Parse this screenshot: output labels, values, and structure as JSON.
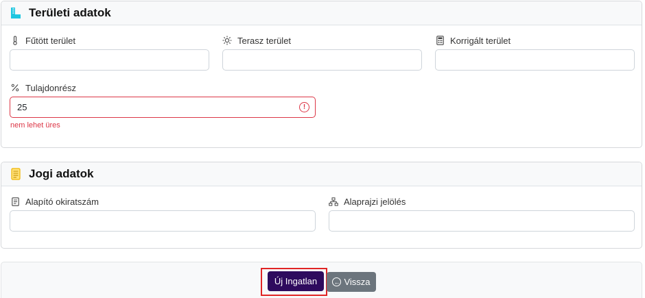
{
  "areal_section": {
    "title": "Területi adatok",
    "icon": "ruler-icon",
    "fields": {
      "heated_area": {
        "label": "Fűtött terület",
        "icon": "thermometer-icon",
        "value": "",
        "placeholder": ""
      },
      "terrace_area": {
        "label": "Terasz terület",
        "icon": "sun-icon",
        "value": "",
        "placeholder": ""
      },
      "corrected_area": {
        "label": "Korrigált terület",
        "icon": "calculator-icon",
        "value": "",
        "placeholder": ""
      },
      "ownership_share": {
        "label": "Tulajdonrész",
        "icon": "percent-icon",
        "value": "25",
        "error": "nem lehet üres"
      }
    }
  },
  "legal_section": {
    "title": "Jogi adatok",
    "icon": "document-icon",
    "fields": {
      "deed_number": {
        "label": "Alapító okiratszám",
        "icon": "file-text-icon",
        "value": ""
      },
      "floor_plan_mark": {
        "label": "Alaprajzi jelölés",
        "icon": "diagram-icon",
        "value": ""
      }
    }
  },
  "actions": {
    "submit_label": "Új Ingatlan",
    "back_label": "Vissza"
  },
  "colors": {
    "primary": "#2e0b5e",
    "secondary": "#6c757d",
    "error": "#dc3545",
    "highlight": "#e02424"
  }
}
